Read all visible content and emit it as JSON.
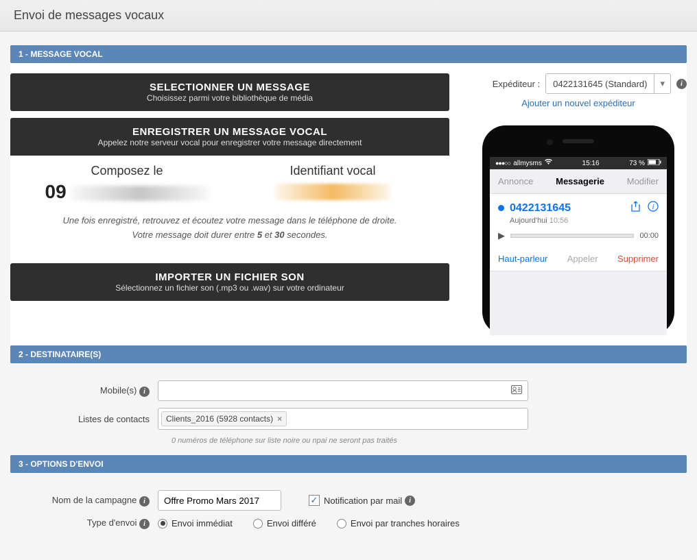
{
  "page_title": "Envoi de messages vocaux",
  "sections": {
    "s1": "1 - MESSAGE VOCAL",
    "s2": "2 - DESTINATAIRE(S)",
    "s3": "3 - OPTIONS D'ENVOI"
  },
  "select_block": {
    "title": "SELECTIONNER UN MESSAGE",
    "sub": "Choisissez parmi votre bibliothèque de média"
  },
  "record_block": {
    "title": "ENREGISTRER UN MESSAGE VOCAL",
    "sub": "Appelez notre serveur vocal pour enregistrer votre message directement",
    "compose_label": "Composez le",
    "compose_prefix": "09",
    "id_label": "Identifiant vocal",
    "note1": "Une fois enregistré, retrouvez et écoutez votre message dans le téléphone de droite.",
    "note2_a": "Votre message doit durer entre ",
    "note2_b": "5",
    "note2_c": " et ",
    "note2_d": "30",
    "note2_e": " secondes."
  },
  "import_block": {
    "title": "IMPORTER UN FICHIER SON",
    "sub": "Sélectionnez un fichier son (.mp3 ou .wav) sur votre ordinateur"
  },
  "sender": {
    "label": "Expéditeur :",
    "value": "0422131645 (Standard)",
    "add_link": "Ajouter un nouvel expéditeur"
  },
  "phone": {
    "carrier": "allmysms",
    "time": "15:16",
    "battery": "73 %",
    "tab_annonce": "Annonce",
    "tab_messagerie": "Messagerie",
    "tab_modifier": "Modifier",
    "number": "0422131645",
    "date": "Aujourd'hui",
    "date_time": "10:56",
    "duration": "00:00",
    "act_hp": "Haut-parleur",
    "act_appeler": "Appeler",
    "act_supprimer": "Supprimer"
  },
  "recipients": {
    "mobiles_label": "Mobile(s)",
    "lists_label": "Listes de contacts",
    "chip": "Clients_2016 (5928 contacts)",
    "hint": "0 numéros de téléphone sur liste noire ou npai ne seront pas traités"
  },
  "options": {
    "campaign_label": "Nom de la campagne",
    "campaign_value": "Offre Promo Mars 2017",
    "notif_label": "Notification par mail",
    "type_label": "Type d'envoi",
    "r1": "Envoi immédiat",
    "r2": "Envoi différé",
    "r3": "Envoi par tranches horaires"
  }
}
